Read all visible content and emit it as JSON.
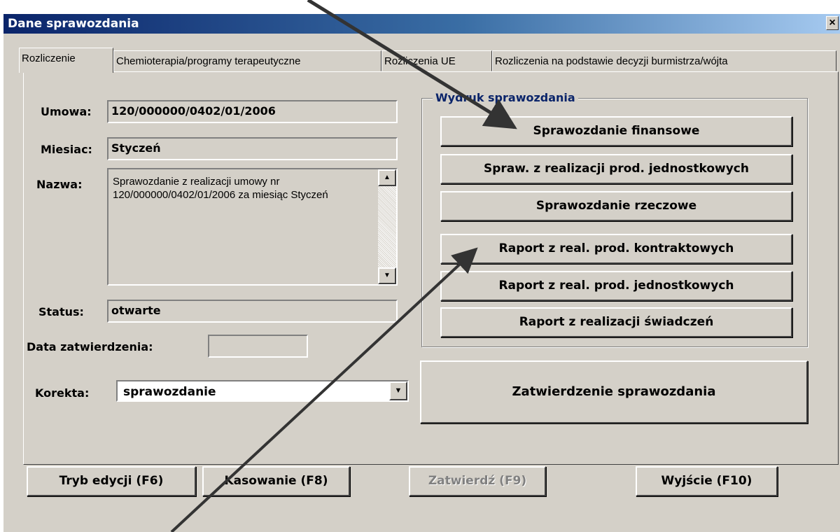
{
  "window": {
    "title": "Dane sprawozdania",
    "close_glyph": "×"
  },
  "tabs": [
    {
      "label": "Rozliczenie",
      "active": true
    },
    {
      "label": "Chemioterapia/programy terapeutyczne",
      "active": false
    },
    {
      "label": "Rozliczenia UE",
      "active": false
    },
    {
      "label": "Rozliczenia na podstawie decyzji burmistrza/wójta",
      "active": false
    }
  ],
  "form": {
    "umowa_label": "Umowa:",
    "umowa_value": "120/000000/0402/01/2006",
    "miesiac_label": "Miesiac:",
    "miesiac_value": "Styczeń",
    "nazwa_label": "Nazwa:",
    "nazwa_value": "Sprawozdanie z realizacji umowy nr 120/000000/0402/01/2006 za miesiąc Styczeń",
    "status_label": "Status:",
    "status_value": "otwarte",
    "data_label": "Data zatwierdzenia:",
    "data_value": "",
    "korekta_label": "Korekta:",
    "korekta_value": "sprawozdanie"
  },
  "print_group": {
    "title": "Wydruk sprawozdania",
    "buttons": [
      "Sprawozdanie finansowe",
      "Spraw. z realizacji prod. jednostkowych",
      "Sprawozdanie rzeczowe",
      "Raport z real. prod. kontraktowych",
      "Raport z real. prod. jednostkowych",
      "Raport z realizacji świadczeń"
    ]
  },
  "approve_button": "Zatwierdzenie sprawozdania",
  "bottom_buttons": {
    "edit": "Tryb edycji (F6)",
    "delete": "Kasowanie (F8)",
    "confirm": "Zatwierdź (F9)",
    "confirm_enabled": false,
    "exit": "Wyjście (F10)"
  },
  "icons": {
    "scroll_up": "up-arrow-icon",
    "scroll_down": "down-arrow-icon",
    "dropdown": "dropdown-arrow-icon"
  },
  "colors": {
    "window_bg": "#d4d0c8",
    "titlebar": "#0a246a",
    "group_title": "#0a246a",
    "annotation_arrows": "#333333"
  }
}
